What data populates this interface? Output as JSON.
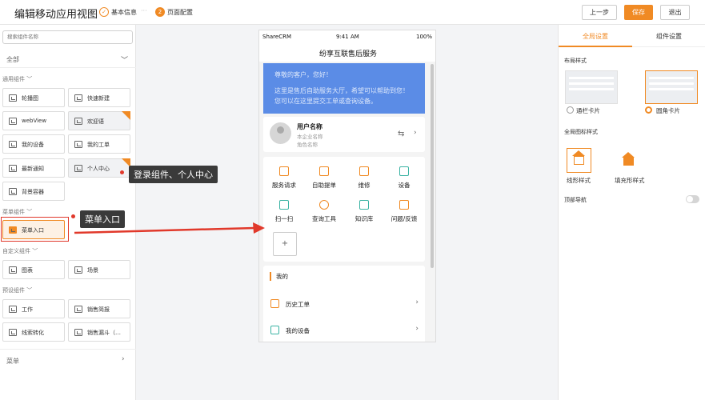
{
  "header": {
    "title": "编辑移动应用视图",
    "steps": [
      {
        "index": "✓",
        "label": "基本信息",
        "state": "done"
      },
      {
        "index": "2",
        "label": "页面配置",
        "state": "active"
      }
    ],
    "step_separator": "···",
    "buttons": {
      "prev": "上一步",
      "save": "保存",
      "exit": "退出"
    },
    "accent_color": "#f08a24"
  },
  "left_panel": {
    "search_placeholder": "搜索组件名称",
    "category_header": "全部",
    "sections": {
      "general": "通用组件",
      "menu": "菜单组件",
      "custom": "自定义组件",
      "preset": "预设组件"
    },
    "general_components": [
      {
        "label": "轮播图"
      },
      {
        "label": "快速新建"
      },
      {
        "label": "webView"
      },
      {
        "label": "欢迎语"
      },
      {
        "label": "我的设备"
      },
      {
        "label": "我的工单"
      },
      {
        "label": "最新通知"
      },
      {
        "label": "个人中心"
      },
      {
        "label": "背景容器"
      }
    ],
    "menu_components": [
      {
        "label": "菜单入口"
      }
    ],
    "custom_components": [
      {
        "label": "图表"
      },
      {
        "label": "场景"
      }
    ],
    "preset_components": [
      {
        "label": "工作"
      },
      {
        "label": "销售简报"
      },
      {
        "label": "线索转化"
      },
      {
        "label": "销售漏斗（…"
      }
    ],
    "bottom_menu": "菜单"
  },
  "callouts": {
    "login_component": "登录组件、个人中心",
    "menu_entry": "菜单入口",
    "highlight_color": "#e1392b"
  },
  "phone": {
    "status_bar": {
      "carrier": "ShareCRM",
      "time": "9:41 AM",
      "battery": "100%"
    },
    "nav_title": "纷享互联售后服务",
    "banner": {
      "line1": "尊敬的客户，您好！",
      "line2": "这里是售后自助服务大厅，希望可以帮助到您！您可以在这里提交工单或查询设备。"
    },
    "user_card": {
      "name": "用户名称",
      "company": "本企业名称",
      "role": "角色名称"
    },
    "grid_items": [
      {
        "label": "服务请求",
        "icon": "service-request-icon",
        "color": "#f08a24"
      },
      {
        "label": "自助提单",
        "icon": "self-order-icon",
        "color": "#f08a24"
      },
      {
        "label": "维修",
        "icon": "repair-icon",
        "color": "#f08a24"
      },
      {
        "label": "设备",
        "icon": "device-icon",
        "color": "#3bb3a3"
      },
      {
        "label": "扫一扫",
        "icon": "scan-icon",
        "color": "#3bb3a3"
      },
      {
        "label": "查询工具",
        "icon": "search-tool-icon",
        "color": "#f08a24"
      },
      {
        "label": "知识库",
        "icon": "knowledge-base-icon",
        "color": "#3bb3a3"
      },
      {
        "label": "问题/反馈",
        "icon": "feedback-icon",
        "color": "#f08a24"
      }
    ],
    "add_button": "+",
    "my_section": {
      "title": "我的",
      "rows": [
        {
          "label": "历史工单",
          "icon": "history-order-icon"
        },
        {
          "label": "我的设备",
          "icon": "my-device-icon"
        }
      ]
    }
  },
  "right_panel": {
    "tabs": [
      {
        "label": "全局设置",
        "active": true
      },
      {
        "label": "组件设置",
        "active": false
      }
    ],
    "layout_style": {
      "label": "布局样式",
      "options": [
        {
          "label": "通栏卡片",
          "selected": false
        },
        {
          "label": "圆角卡片",
          "selected": true
        }
      ]
    },
    "icon_style": {
      "label": "全局图标样式",
      "options": [
        {
          "label": "线形样式",
          "selected": true
        },
        {
          "label": "填充形样式",
          "selected": false
        }
      ]
    },
    "top_nav": {
      "label": "顶部导航",
      "enabled": false
    }
  }
}
